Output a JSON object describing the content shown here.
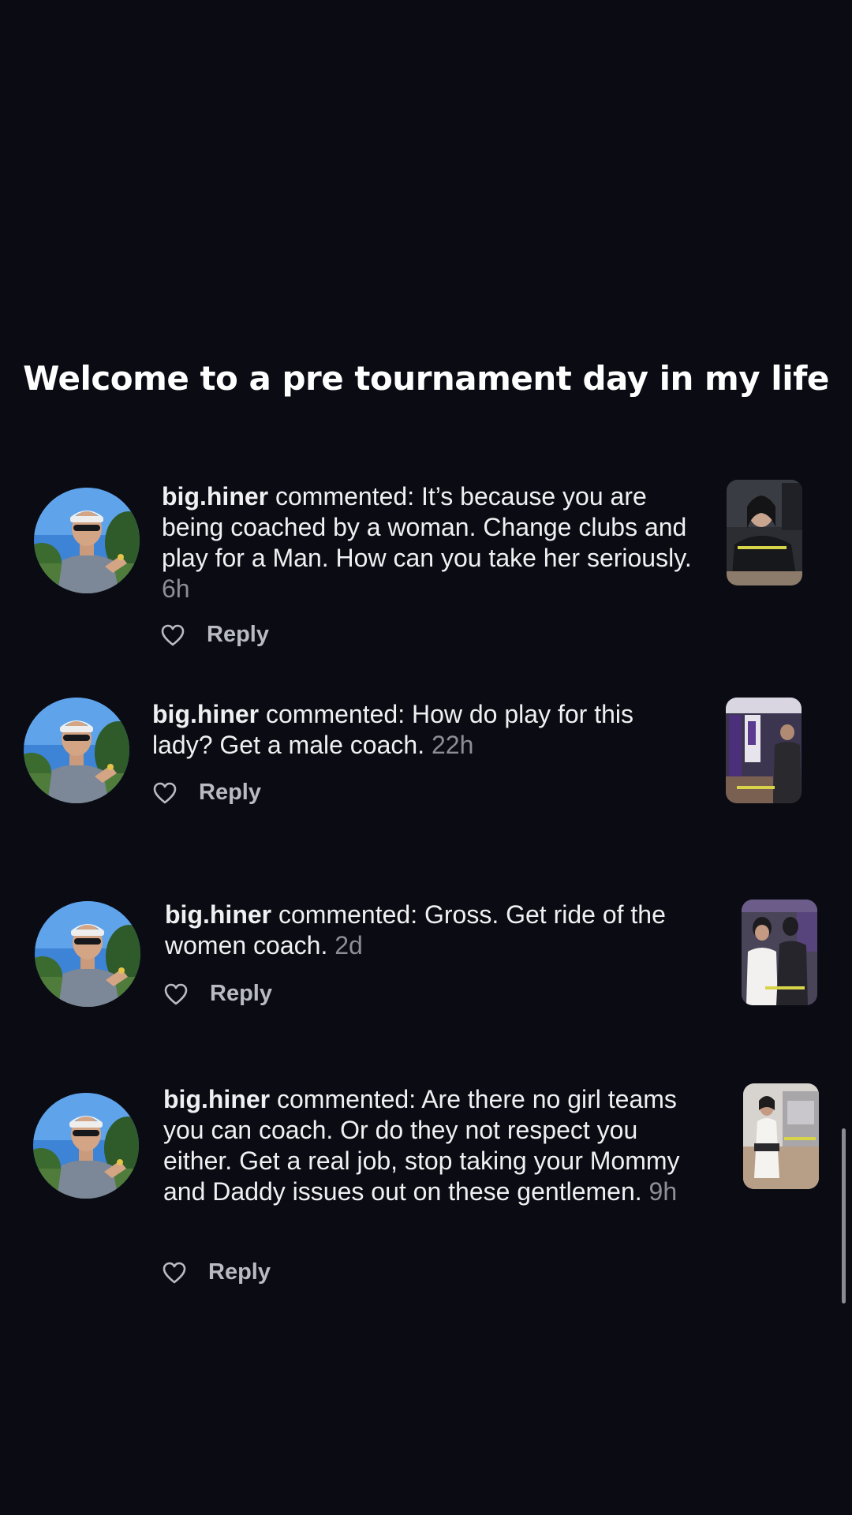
{
  "headline": "Welcome to a pre tournament day in my life",
  "comments": [
    {
      "username": "big.hiner",
      "verb": "commented:",
      "text": "It’s because you are being coached by a woman. Change clubs and play for a Man. How can you take her seriously.",
      "time": "6h",
      "reply_label": "Reply",
      "avatar_icon": "profile-photo-man-cap-sunglasses",
      "thumb_icon": "video-thumbnail-woman-coach"
    },
    {
      "username": "big.hiner",
      "verb": "commented:",
      "text": "How do play for this lady? Get a male coach.",
      "time": "22h",
      "reply_label": "Reply",
      "avatar_icon": "profile-photo-man-cap-sunglasses",
      "thumb_icon": "video-thumbnail-gym-court"
    },
    {
      "username": "big.hiner",
      "verb": "commented:",
      "text": "Gross. Get ride of the women coach.",
      "time": "2d",
      "reply_label": "Reply",
      "avatar_icon": "profile-photo-man-cap-sunglasses",
      "thumb_icon": "video-thumbnail-players"
    },
    {
      "username": "big.hiner",
      "verb": "commented:",
      "text": "Are there no girl teams you can coach. Or do they not respect you either. Get a real job, stop taking your Mommy and Daddy issues out on these gentlemen.",
      "time": "9h",
      "reply_label": "Reply",
      "avatar_icon": "profile-photo-man-cap-sunglasses",
      "thumb_icon": "video-thumbnail-coach-standing"
    }
  ],
  "colors": {
    "background": "#0b0c13",
    "text": "#f0f0f3",
    "muted": "#8c8e98"
  }
}
